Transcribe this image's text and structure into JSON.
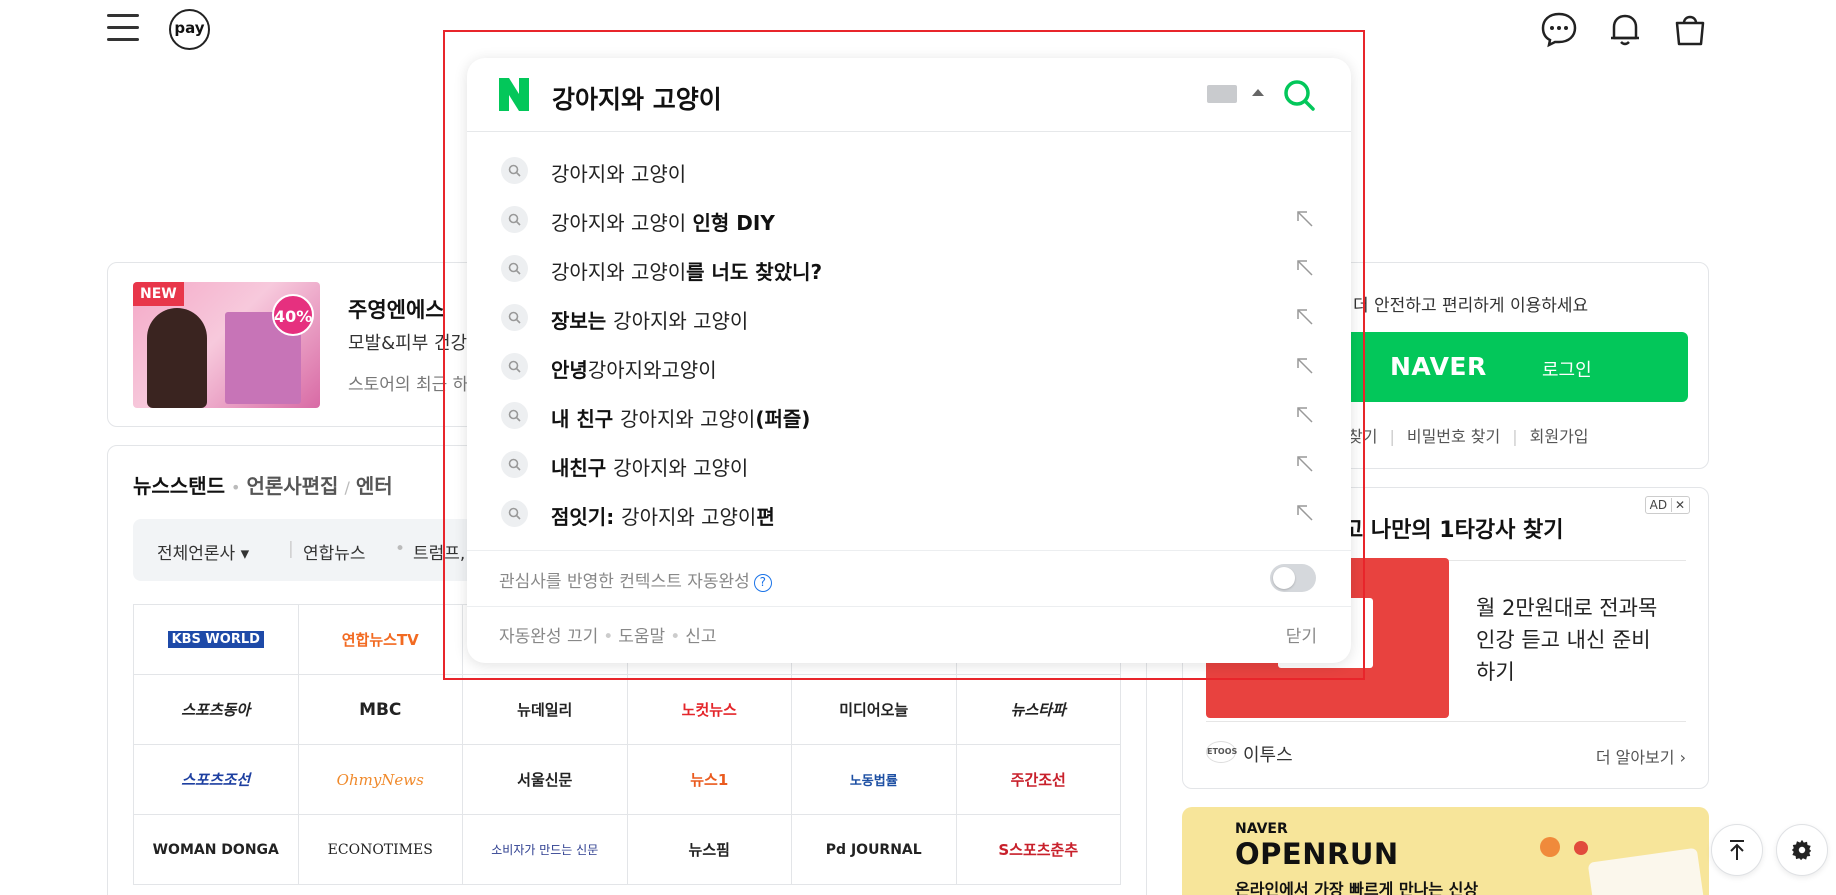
{
  "topbar": {
    "pay_label": "pay",
    "icons": [
      "menu-icon",
      "pay-icon",
      "talk-icon",
      "bell-icon",
      "shopping-bag-icon"
    ]
  },
  "shopping": {
    "badge_new": "NEW",
    "badge_discount": "40%",
    "brand": "주영엔에스",
    "subtitle": "모발&피부 건강",
    "description": "스토어의 최근 하"
  },
  "newsstand": {
    "tabs": [
      "뉴스스탠드",
      "언론사편집",
      "엔터"
    ],
    "filter": {
      "dropdown": "전체언론사",
      "items": [
        "연합뉴스",
        "트럼프, 백"
      ]
    },
    "press_rows": [
      [
        "KBS WORLD",
        "연합뉴스TV",
        "",
        "",
        "",
        ""
      ],
      [
        "스포츠동아",
        "MBC",
        "뉴데일리",
        "노컷뉴스",
        "미디어오늘",
        "뉴스타파"
      ],
      [
        "스포츠조선",
        "OhmyNews",
        "서울신문",
        "뉴스1",
        "노동법률",
        "주간조선"
      ],
      [
        "WOMAN DONGA",
        "ECONOTIMES",
        "소비자가 만드는 신문",
        "뉴스핌",
        "Pd JOURNAL",
        "S스포츠춘추"
      ]
    ]
  },
  "login": {
    "prompt": "더 안전하고 편리하게 이용하세요",
    "button_brand": "NAVER",
    "button_label": "로그인",
    "links": [
      "찾기",
      "비밀번호 찾기",
      "회원가입"
    ]
  },
  "ad": {
    "badge": "AD",
    "title": "고 나만의 1타강사 찾기",
    "copy": "월 2만원대로 전과목 인강 듣고 내신 준비하기",
    "brand_icon": "ETOOS",
    "brand": "이투스",
    "more": "더 알아보기"
  },
  "openrun": {
    "brand": "NAVER",
    "title": "OPENRUN",
    "tagline": "온라인에서 가장 빠르게 만나는 신상"
  },
  "search_overlay": {
    "query": "강아지와 고양이",
    "suggestions": [
      {
        "pre": "",
        "bold": "",
        "text": "강아지와 고양이",
        "tail": "",
        "arrow": false
      },
      {
        "pre": "",
        "bold": "",
        "text": "강아지와 고양이 ",
        "tail": "인형 DIY",
        "arrow": true
      },
      {
        "pre": "",
        "bold": "",
        "text": "강아지와 고양이",
        "tail": "를 너도 찾았니?",
        "arrow": true
      },
      {
        "pre": "장보는 ",
        "bold": "",
        "text": "강아지와 고양이",
        "tail": "",
        "arrow": true
      },
      {
        "pre": "안녕",
        "bold": "",
        "text": "강아지와고양이",
        "tail": "",
        "arrow": true
      },
      {
        "pre": "내 친구 ",
        "bold": "",
        "text": "강아지와 고양이",
        "tail": "(퍼즐)",
        "arrow": true
      },
      {
        "pre": "내친구 ",
        "bold": "",
        "text": "강아지와 고양이",
        "tail": "",
        "arrow": true
      },
      {
        "pre": "점잇기: ",
        "bold": "",
        "text": "강아지와 고양이",
        "tail": "편",
        "arrow": true
      }
    ],
    "context_label": "관심사를 반영한 컨텍스트 자동완성",
    "context_help": "?",
    "context_toggle_on": false,
    "footer_links": [
      "자동완성 끄기",
      "도움말",
      "신고"
    ],
    "close_label": "닫기",
    "accent_color": "#03c75a",
    "highlight_frame_color": "#e8252b"
  },
  "floating": {
    "scroll_top": "scroll-top-icon",
    "settings": "settings-icon"
  }
}
